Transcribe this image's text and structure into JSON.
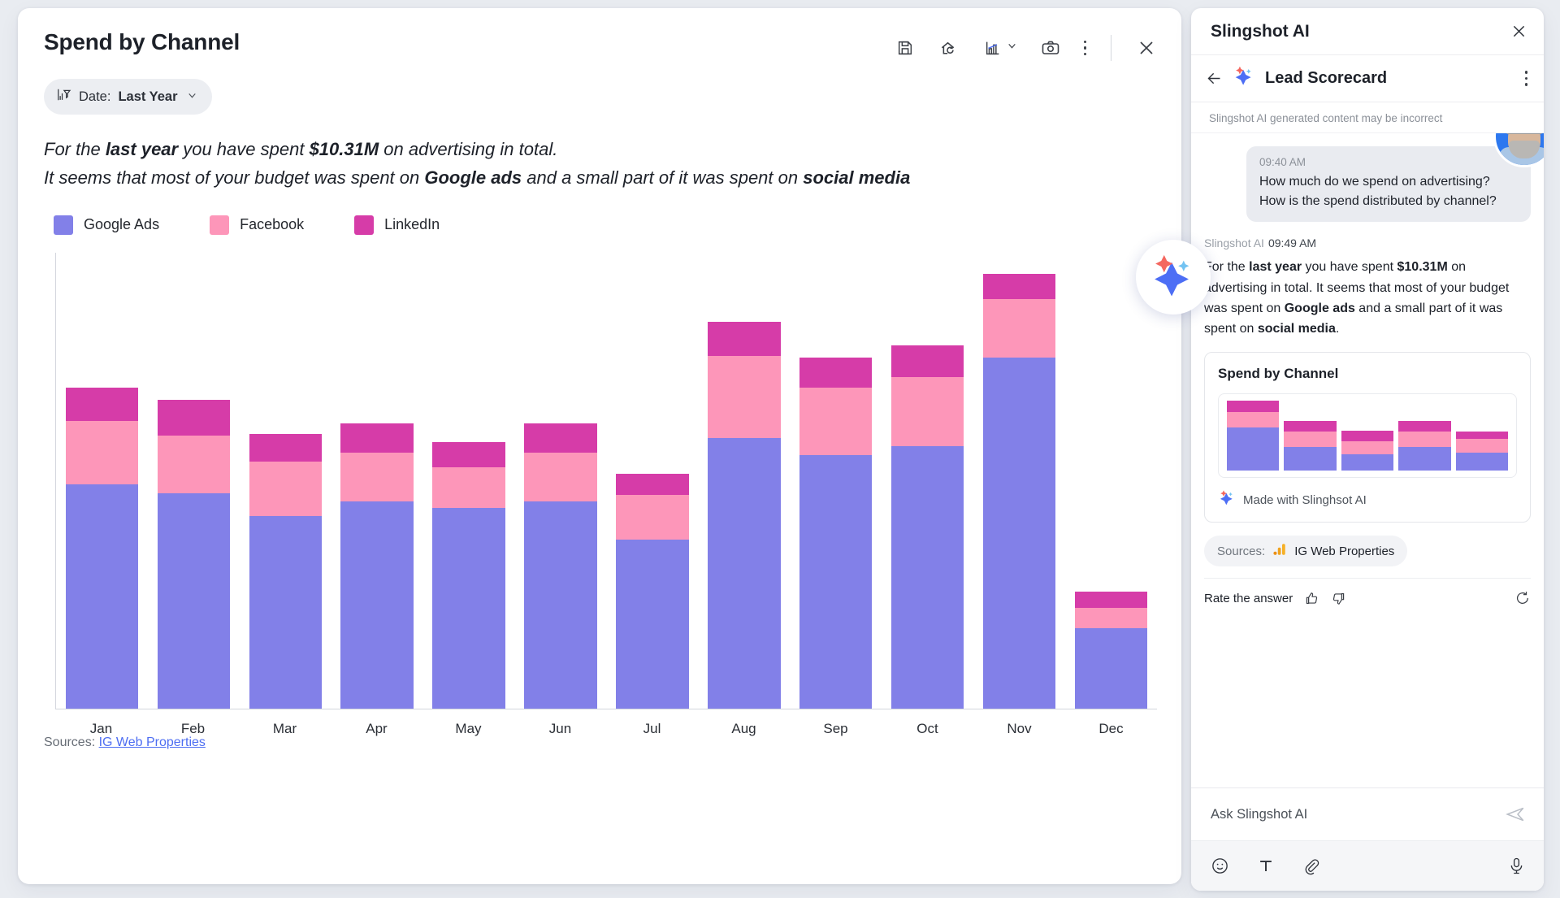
{
  "chart_panel": {
    "title": "Spend by Channel",
    "filter": {
      "icon": "filter-chart-icon",
      "label": "Date:",
      "value": "Last Year",
      "caret": "⌄"
    },
    "toolbar": [
      {
        "name": "save-icon",
        "title": "Save"
      },
      {
        "name": "home-refresh-icon",
        "title": "Reset"
      },
      {
        "name": "chart-type-icon",
        "title": "Chart type"
      },
      {
        "name": "camera-icon",
        "title": "Snapshot"
      },
      {
        "name": "more-options-icon",
        "title": "More"
      },
      {
        "name": "close-icon",
        "title": "Close"
      }
    ],
    "narrative": {
      "line1_a": "For the ",
      "line1_b": "last year",
      "line1_c": " you have spent ",
      "line1_d": "$10.31M",
      "line1_e": " on advertising in total.",
      "line2_a": "It seems that most of your budget was spent on ",
      "line2_b": "Google ads",
      "line2_c": " and a small part of it was spent on ",
      "line2_d": "social media"
    },
    "sources_label": "Sources:",
    "sources_link": "IG Web Properties"
  },
  "chart_data": {
    "type": "bar",
    "subtype": "stacked",
    "title": "Spend by Channel",
    "xlabel": "",
    "ylabel": "",
    "grid": false,
    "legend_position": "top-left",
    "categories": [
      "Jan",
      "Feb",
      "Mar",
      "Apr",
      "May",
      "Jun",
      "Jul",
      "Aug",
      "Sep",
      "Oct",
      "Nov",
      "Dec"
    ],
    "series": [
      {
        "name": "Google Ads",
        "color": "#8280e8",
        "values": [
          0.53,
          0.51,
          0.455,
          0.49,
          0.475,
          0.49,
          0.4,
          0.64,
          0.6,
          0.62,
          0.83,
          0.19
        ]
      },
      {
        "name": "Facebook",
        "color": "#fd96b9",
        "values": [
          0.15,
          0.135,
          0.13,
          0.115,
          0.095,
          0.115,
          0.105,
          0.195,
          0.16,
          0.165,
          0.14,
          0.047
        ]
      },
      {
        "name": "LinkedIn",
        "color": "#d63ca8",
        "values": [
          0.08,
          0.085,
          0.065,
          0.07,
          0.06,
          0.07,
          0.05,
          0.08,
          0.07,
          0.075,
          0.06,
          0.04
        ]
      }
    ],
    "ylim": [
      0,
      1.08
    ],
    "total_label": "$10.31M"
  },
  "ai_panel": {
    "title": "Slingshot AI",
    "close_icon": "close-icon",
    "back_icon": "back-arrow-icon",
    "sparkle_icon": "sparkle-icon",
    "subtitle": "Lead Scorecard",
    "kebab_icon": "more-options-icon",
    "disclaimer": "Slingshot AI generated content may be incorrect",
    "user_message": {
      "time": "09:40 AM",
      "text": "How much do we spend on advertising? How is the spend distributed by channel?",
      "avatar": "user-avatar"
    },
    "ai_message": {
      "author": "Slingshot AI",
      "time": "09:49 AM",
      "body_a": "For the ",
      "body_b": "last year",
      "body_c": " you have spent ",
      "body_d": "$10.31M",
      "body_e": " on advertising in total. It seems that most of your budget was spent on ",
      "body_f": "Google ads",
      "body_g": " and a small part of it was spent on ",
      "body_h": "social media",
      "body_i": "."
    },
    "card": {
      "title": "Spend by Channel",
      "made_with": "Made with Slinghsot AI",
      "mini_chart": {
        "type": "bar",
        "subtype": "stacked",
        "bars": [
          {
            "google": 62,
            "facebook": 22,
            "linkedin": 16
          },
          {
            "google": 34,
            "facebook": 22,
            "linkedin": 15
          },
          {
            "google": 24,
            "facebook": 18,
            "linkedin": 16
          },
          {
            "google": 34,
            "facebook": 22,
            "linkedin": 16
          },
          {
            "google": 26,
            "facebook": 20,
            "linkedin": 10
          }
        ]
      }
    },
    "sources": {
      "label": "Sources:",
      "value": "IG Web Properties",
      "icon": "google-analytics-icon"
    },
    "rate": {
      "label": "Rate the answer",
      "up_icon": "thumbs-up-icon",
      "down_icon": "thumbs-down-icon",
      "refresh_icon": "refresh-icon"
    },
    "composer": {
      "placeholder": "Ask Slingshot AI",
      "send_icon": "send-icon",
      "emoji_icon": "emoji-icon",
      "text_icon": "text-format-icon",
      "attach_icon": "attachment-icon",
      "mic_icon": "microphone-icon"
    }
  },
  "float_button": {
    "name": "slingshot-sparkle-button"
  },
  "colors": {
    "google_ads": "#8280e8",
    "facebook": "#fd96b9",
    "linkedin": "#d63ca8",
    "link": "#4e6ef2"
  }
}
